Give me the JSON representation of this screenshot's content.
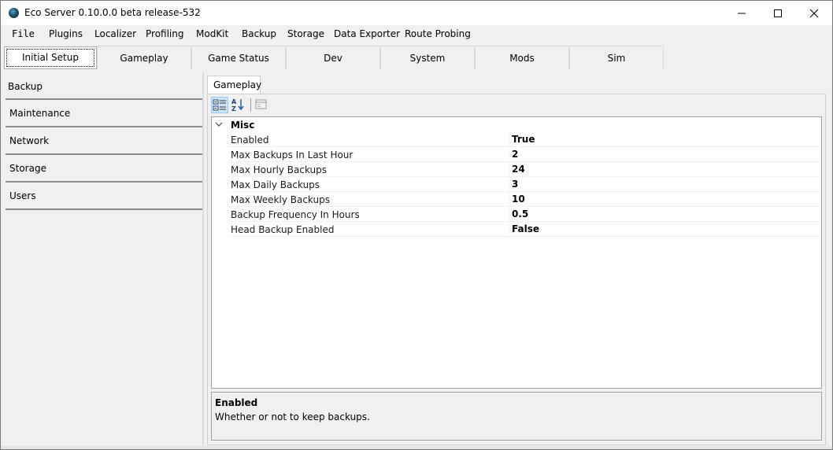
{
  "window": {
    "title": "Eco Server 0.10.0.0 beta release-532"
  },
  "menu": {
    "items": [
      {
        "label": "File"
      },
      {
        "label": "Plugins"
      },
      {
        "label": "Localizer"
      },
      {
        "label": "Profiling"
      },
      {
        "label": "ModKit"
      },
      {
        "label": "Backup"
      },
      {
        "label": "Storage"
      },
      {
        "label": "Data Exporter"
      },
      {
        "label": "Route Probing"
      }
    ]
  },
  "tabs": {
    "items": [
      {
        "label": "Initial Setup",
        "active": true
      },
      {
        "label": "Gameplay"
      },
      {
        "label": "Game Status"
      },
      {
        "label": "Dev"
      },
      {
        "label": "System"
      },
      {
        "label": "Mods"
      },
      {
        "label": "Sim"
      }
    ]
  },
  "sidebar": {
    "items": [
      {
        "label": "Backup"
      },
      {
        "label": "Maintenance"
      },
      {
        "label": "Network"
      },
      {
        "label": "Storage"
      },
      {
        "label": "Users"
      }
    ]
  },
  "panel": {
    "tab_label": "Gameplay",
    "toolbar": {
      "categorized_icon": "categorized-icon",
      "alphabetical_icon": "sort-alphabetical-icon",
      "property_pages_icon": "property-pages-icon"
    },
    "category": {
      "label": "Misc",
      "expanded": true
    },
    "properties": [
      {
        "name": "Enabled",
        "value": "True"
      },
      {
        "name": "Max Backups In Last Hour",
        "value": "2"
      },
      {
        "name": "Max Hourly Backups",
        "value": "24"
      },
      {
        "name": "Max Daily Backups",
        "value": "3"
      },
      {
        "name": "Max Weekly Backups",
        "value": "10"
      },
      {
        "name": "Backup Frequency In Hours",
        "value": "0.5"
      },
      {
        "name": "Head Backup Enabled",
        "value": "False"
      }
    ],
    "help": {
      "title": "Enabled",
      "description": "Whether or not to keep backups."
    }
  },
  "colors": {
    "window_bg": "#f0f0f0",
    "toolbar_pressed": "#cce4f7",
    "border": "#a0a0a0"
  }
}
